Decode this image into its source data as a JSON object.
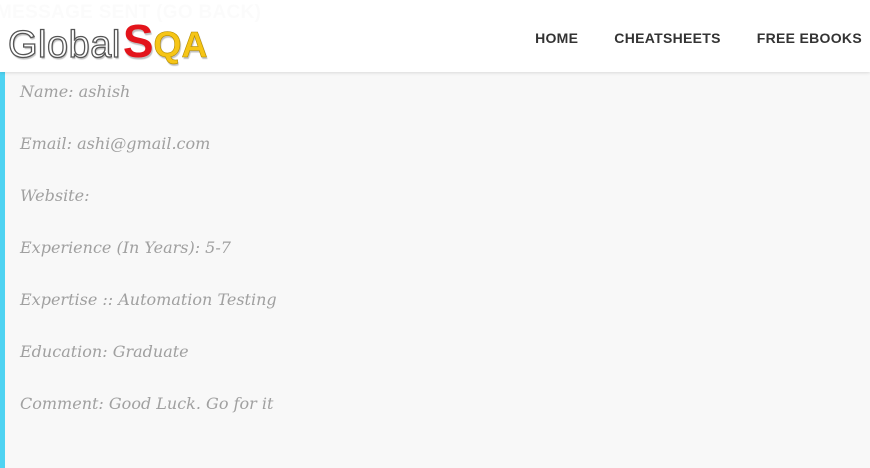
{
  "heading": "MESSAGE SENT (GO BACK)",
  "logo": {
    "part1": "Global",
    "part2": "S",
    "part3": "QA"
  },
  "nav": {
    "items": [
      "HOME",
      "CHEATSHEETS",
      "FREE EBOOKS"
    ]
  },
  "submission": {
    "fields": [
      "Name: ashish",
      "Email: ashi@gmail.com",
      "Website:",
      "Experience (In Years): 5-7",
      "Expertise :: Automation Testing",
      "Education: Graduate",
      "Comment: Good Luck. Go for it"
    ]
  },
  "colors": {
    "accent_border": "#4fd3f2",
    "logo_red": "#e3141b",
    "logo_yellow": "#f6c516",
    "field_text": "#a0a0a0"
  }
}
